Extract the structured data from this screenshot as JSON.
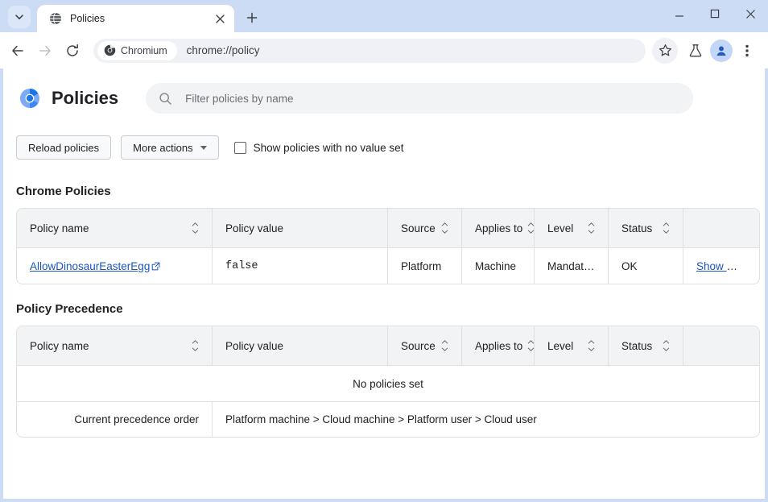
{
  "browser": {
    "tab_search_icon": "chevron-down-icon",
    "tab": {
      "title": "Policies",
      "favicon": "globe-icon",
      "close_icon": "close-icon"
    },
    "new_tab_icon": "plus-icon",
    "window_controls": {
      "minimize": "minimize-icon",
      "maximize": "maximize-icon",
      "close": "close-icon"
    },
    "toolbar": {
      "back_icon": "back-arrow-icon",
      "forward_icon": "forward-arrow-icon",
      "reload_icon": "reload-icon",
      "chip_label": "Chromium",
      "chip_icon": "chromium-icon",
      "url": "chrome://policy",
      "bookmark_icon": "star-icon",
      "labs_icon": "flask-icon",
      "profile_icon": "person-icon",
      "menu_icon": "three-dot-menu-icon"
    }
  },
  "page": {
    "logo": "chromium-logo-icon",
    "title": "Policies",
    "search": {
      "icon": "search-icon",
      "placeholder": "Filter policies by name",
      "value": ""
    },
    "reload_button": "Reload policies",
    "more_actions_button": "More actions",
    "show_no_value_checkbox": {
      "label": "Show policies with no value set",
      "checked": false
    },
    "chrome_policies": {
      "section_title": "Chrome Policies",
      "columns": [
        "Policy name",
        "Policy value",
        "Source",
        "Applies to",
        "Level",
        "Status",
        ""
      ],
      "rows": [
        {
          "name": "AllowDinosaurEasterEgg",
          "name_external_link_icon": "external-link-icon",
          "value": "false",
          "source": "Platform",
          "applies_to": "Machine",
          "level": "Mandatory",
          "status": "OK",
          "action": "Show more"
        }
      ]
    },
    "policy_precedence": {
      "section_title": "Policy Precedence",
      "columns": [
        "Policy name",
        "Policy value",
        "Source",
        "Applies to",
        "Level",
        "Status",
        ""
      ],
      "empty_message": "No policies set",
      "precedence_label": "Current precedence order",
      "precedence_value": "Platform machine > Cloud machine > Platform user > Cloud user"
    }
  },
  "colors": {
    "link": "#1a56c4",
    "header_bg": "#f1f3f4",
    "frame": "#ccdcf5",
    "accent": "#1a73e8"
  }
}
